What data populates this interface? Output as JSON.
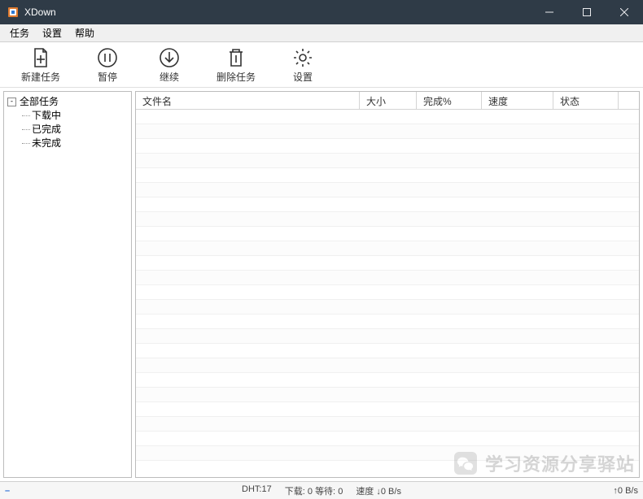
{
  "window": {
    "title": "XDown"
  },
  "menu": {
    "tasks": "任务",
    "settings": "设置",
    "help": "帮助"
  },
  "toolbar": {
    "new_task": "新建任务",
    "pause": "暂停",
    "resume": "继续",
    "delete": "删除任务",
    "settings": "设置"
  },
  "tree": {
    "root": "全部任务",
    "downloading": "下载中",
    "completed": "已完成",
    "incomplete": "未完成",
    "toggle_symbol": "-"
  },
  "columns": {
    "filename": "文件名",
    "size": "大小",
    "done_pct": "完成%",
    "speed": "速度",
    "status": "状态"
  },
  "status": {
    "dash": "–",
    "dht_label": "DHT:",
    "dht_value": "17",
    "download_label": "下载:",
    "download_count": "0",
    "wait_label": "等待:",
    "wait_count": "0",
    "speed_label": "速度",
    "down_speed": "0 B/s",
    "up_speed": "0 B/s",
    "arrow_down": "↓",
    "arrow_up": "↑"
  },
  "watermark": {
    "text": "学习资源分享驿站"
  }
}
